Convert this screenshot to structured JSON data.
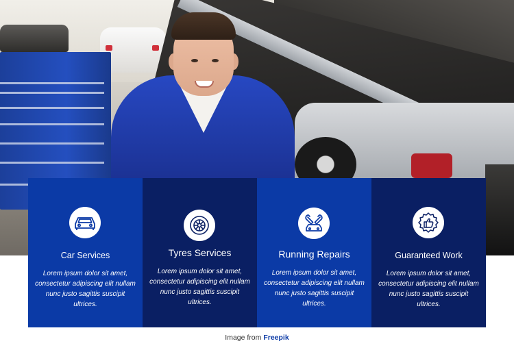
{
  "features": [
    {
      "icon": "car-icon",
      "title": "Car Services",
      "description": "Lorem ipsum dolor sit amet, consectetur adipiscing elit nullam nunc justo sagittis suscipit ultrices."
    },
    {
      "icon": "tire-icon",
      "title": "Tyres Services",
      "description": "Lorem ipsum dolor sit amet, consectetur adipiscing elit nullam nunc justo sagittis suscipit ultrices."
    },
    {
      "icon": "wrench-car-icon",
      "title": "Running Repairs",
      "description": "Lorem ipsum dolor sit amet, consectetur adipiscing elit nullam nunc justo sagittis suscipit ultrices."
    },
    {
      "icon": "badge-thumbs-up-icon",
      "title": "Guaranteed Work",
      "description": "Lorem ipsum dolor sit amet, consectetur adipiscing elit nullam nunc justo sagittis suscipit ultrices."
    }
  ],
  "credit": {
    "prefix": "Image from",
    "link_label": "Freepik"
  },
  "colors": {
    "card_primary": "#0b3aa6",
    "card_dark": "#0a1f63",
    "link": "#0b3aa6"
  }
}
